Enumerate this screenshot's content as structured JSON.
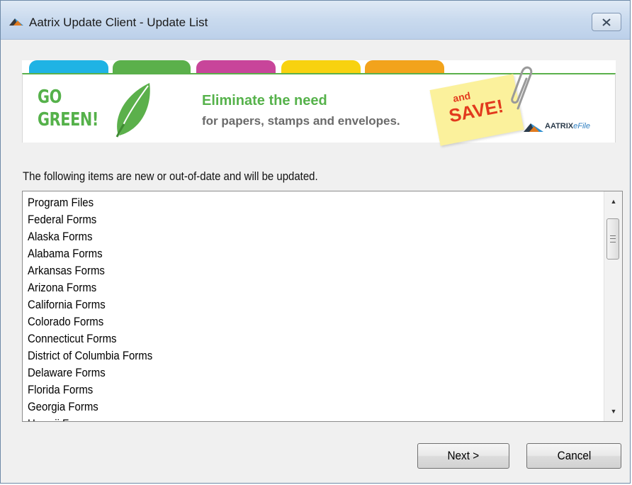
{
  "window": {
    "title": "Aatrix Update Client - Update List",
    "close_glyph": "✕"
  },
  "banner": {
    "tab_colors": [
      "#1fb3e4",
      "#5bb04b",
      "#c8459a",
      "#f8d20f",
      "#f2a31c"
    ],
    "go": "GO",
    "green": "GREEN!",
    "eliminate": "Eliminate the need",
    "for_papers": "for papers, stamps and envelopes.",
    "and": "and",
    "save": "SAVE!",
    "logo_brand": "AATRIX",
    "logo_sub": "eFile",
    "accent_green": "#56b24b",
    "accent_red": "#e2391d"
  },
  "instructions": "The following items are new or out-of-date and will be updated.",
  "update_list": {
    "items": [
      "Program Files",
      "Federal Forms",
      "Alaska Forms",
      "Alabama Forms",
      "Arkansas Forms",
      "Arizona Forms",
      "California Forms",
      "Colorado Forms",
      "Connecticut Forms",
      "District of Columbia Forms",
      "Delaware Forms",
      "Florida Forms",
      "Georgia Forms",
      "Hawaii Forms"
    ]
  },
  "buttons": {
    "next": "Next >",
    "cancel": "Cancel"
  }
}
